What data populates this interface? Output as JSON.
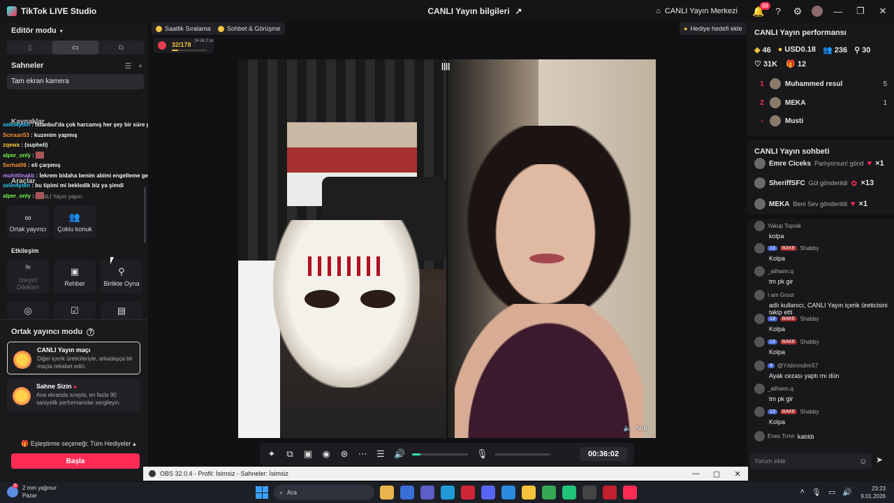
{
  "titlebar": {
    "app_title": "TikTok LIVE Studio",
    "center_title": "CANLI Yayın bilgileri",
    "hub_label": "CANLI Yayın Merkezi",
    "notif_count": "88"
  },
  "left": {
    "editor_mode": "Editör modu",
    "scenes_title": "Sahneler",
    "scene_item": "Tam ekran kamera",
    "sources_title": "Kaynaklar",
    "tools_title": "Araçlar",
    "tools_subtitle": "CANLI Yayın yapın",
    "interaction_title": "Etkileşim",
    "tools": [
      {
        "label": "Ortak yayıncı"
      },
      {
        "label": "Çoklu konuk"
      }
    ],
    "interaction": [
      {
        "label": "İzleyici Dilekleri"
      },
      {
        "label": "Rehber"
      },
      {
        "label": "Birlikte Oyna"
      }
    ]
  },
  "overlay_chat": [
    {
      "user": "selin4ydin",
      "text": ": İstanbul'da çok harcamış her şey bir süre para ile alakalı ..."
    },
    {
      "user": "Sciraan53",
      "text": ": kuzenim yapmış"
    },
    {
      "user": "zqewa",
      "text": ": (supheli)"
    },
    {
      "user": "alper_only",
      "text": ":"
    },
    {
      "user": "Serhat06",
      "text": ": eli çarpmış"
    },
    {
      "user": "muhittinakb",
      "text": ": İekrem bidaha benim abimi engelleme gelir oraya terliğini çalarım"
    },
    {
      "user": "selin4ydin",
      "text": ": bu tipimi mi bekledik biz ya şimdi"
    },
    {
      "user": "alper_only",
      "text": ":"
    }
  ],
  "cohost": {
    "title": "Ortak yayıncı modu",
    "cards": [
      {
        "title": "CANLI Yayın maçı",
        "desc": "Diğer içerik üreticileriyle, arkadaşça bir maçta rekabet edin."
      },
      {
        "title": "Sahne Sizin",
        "desc": "Ana ekranda sırayla, en fazla 90 saniyelik performanslar sergileyin."
      }
    ],
    "match_option": "Eşleştirme seçeneği: Tüm Hediyeler",
    "start_button": "Başla"
  },
  "center": {
    "pill_hourly": "Saatlik Sıralama",
    "pill_chat": "Sohbet & Görüşme",
    "gift_goal": "Hediye hedefi ekle",
    "gift_progress": "32/178",
    "gift_progress_fraction": 0.18,
    "gift_time": "24 dk 2 sn",
    "cohost_name": "Nur",
    "timer": "00:36:02"
  },
  "right": {
    "perf_title": "CANLI Yayın performansı",
    "stats": {
      "diamonds": "46",
      "usd": "USD0.18",
      "viewers": "236",
      "followers": "30",
      "likes": "31K",
      "gifts": "12"
    },
    "ranking": [
      {
        "rank": "1",
        "name": "Muhammed resul",
        "score": "5"
      },
      {
        "rank": "2",
        "name": "MEKA",
        "score": "1"
      },
      {
        "rank": "-",
        "name": "Musti",
        "score": ""
      }
    ],
    "chat_title": "CANLI Yayın sohbeti",
    "gift_msgs": [
      {
        "name": "Emre Ciceks",
        "msg": "Parlıyorsun! gönd",
        "mult": "×1"
      },
      {
        "name": "SheriffSFC",
        "msg": "Gül gönderildi",
        "mult": "×13"
      },
      {
        "name": "MEKA",
        "msg": "Beni Sev gönderildi",
        "mult": "×1"
      }
    ],
    "chat": [
      {
        "user": "Yakup Toprak",
        "level": "",
        "fan": "",
        "msg": "kolpa"
      },
      {
        "user": "Shabby",
        "level": "13",
        "fan": "BAKE",
        "msg": "Kolpa"
      },
      {
        "user": "_alihann.q",
        "level": "",
        "fan": "",
        "msg": "tm pk gir"
      },
      {
        "user": "I am Groot",
        "level": "",
        "fan": "",
        "msg": "adlı kullanıcı, CANLI Yayın içerik üreticisini takip etti"
      },
      {
        "user": "Shabby",
        "level": "13",
        "fan": "BAKE",
        "msg": "Kolpa"
      },
      {
        "user": "Shabby",
        "level": "13",
        "fan": "BAKE",
        "msg": "Kolpa"
      },
      {
        "user": "@Yıldırımdmr57",
        "level": "4",
        "fan": "",
        "msg": "Ayak cezası yaptı mı dün"
      },
      {
        "user": "_alihann.q",
        "level": "",
        "fan": "",
        "msg": "tm pk gir"
      },
      {
        "user": "Shabby",
        "level": "13",
        "fan": "BAKE",
        "msg": "Kolpa"
      },
      {
        "user": "Enes Trmn",
        "level": "",
        "fan": "",
        "msg": "katıldı"
      }
    ],
    "input_placeholder": "Yorum ekle"
  },
  "obs": {
    "title": "OBS 32.0.4 - Profil: İsimsiz - Sahneler: İsimsiz"
  },
  "taskbar": {
    "weather_badge": "6",
    "weather_text": "2 mm yağmur",
    "weather_day": "Pazar",
    "search_label": "Ara",
    "time": "23:23",
    "date": "9.01.2026"
  }
}
